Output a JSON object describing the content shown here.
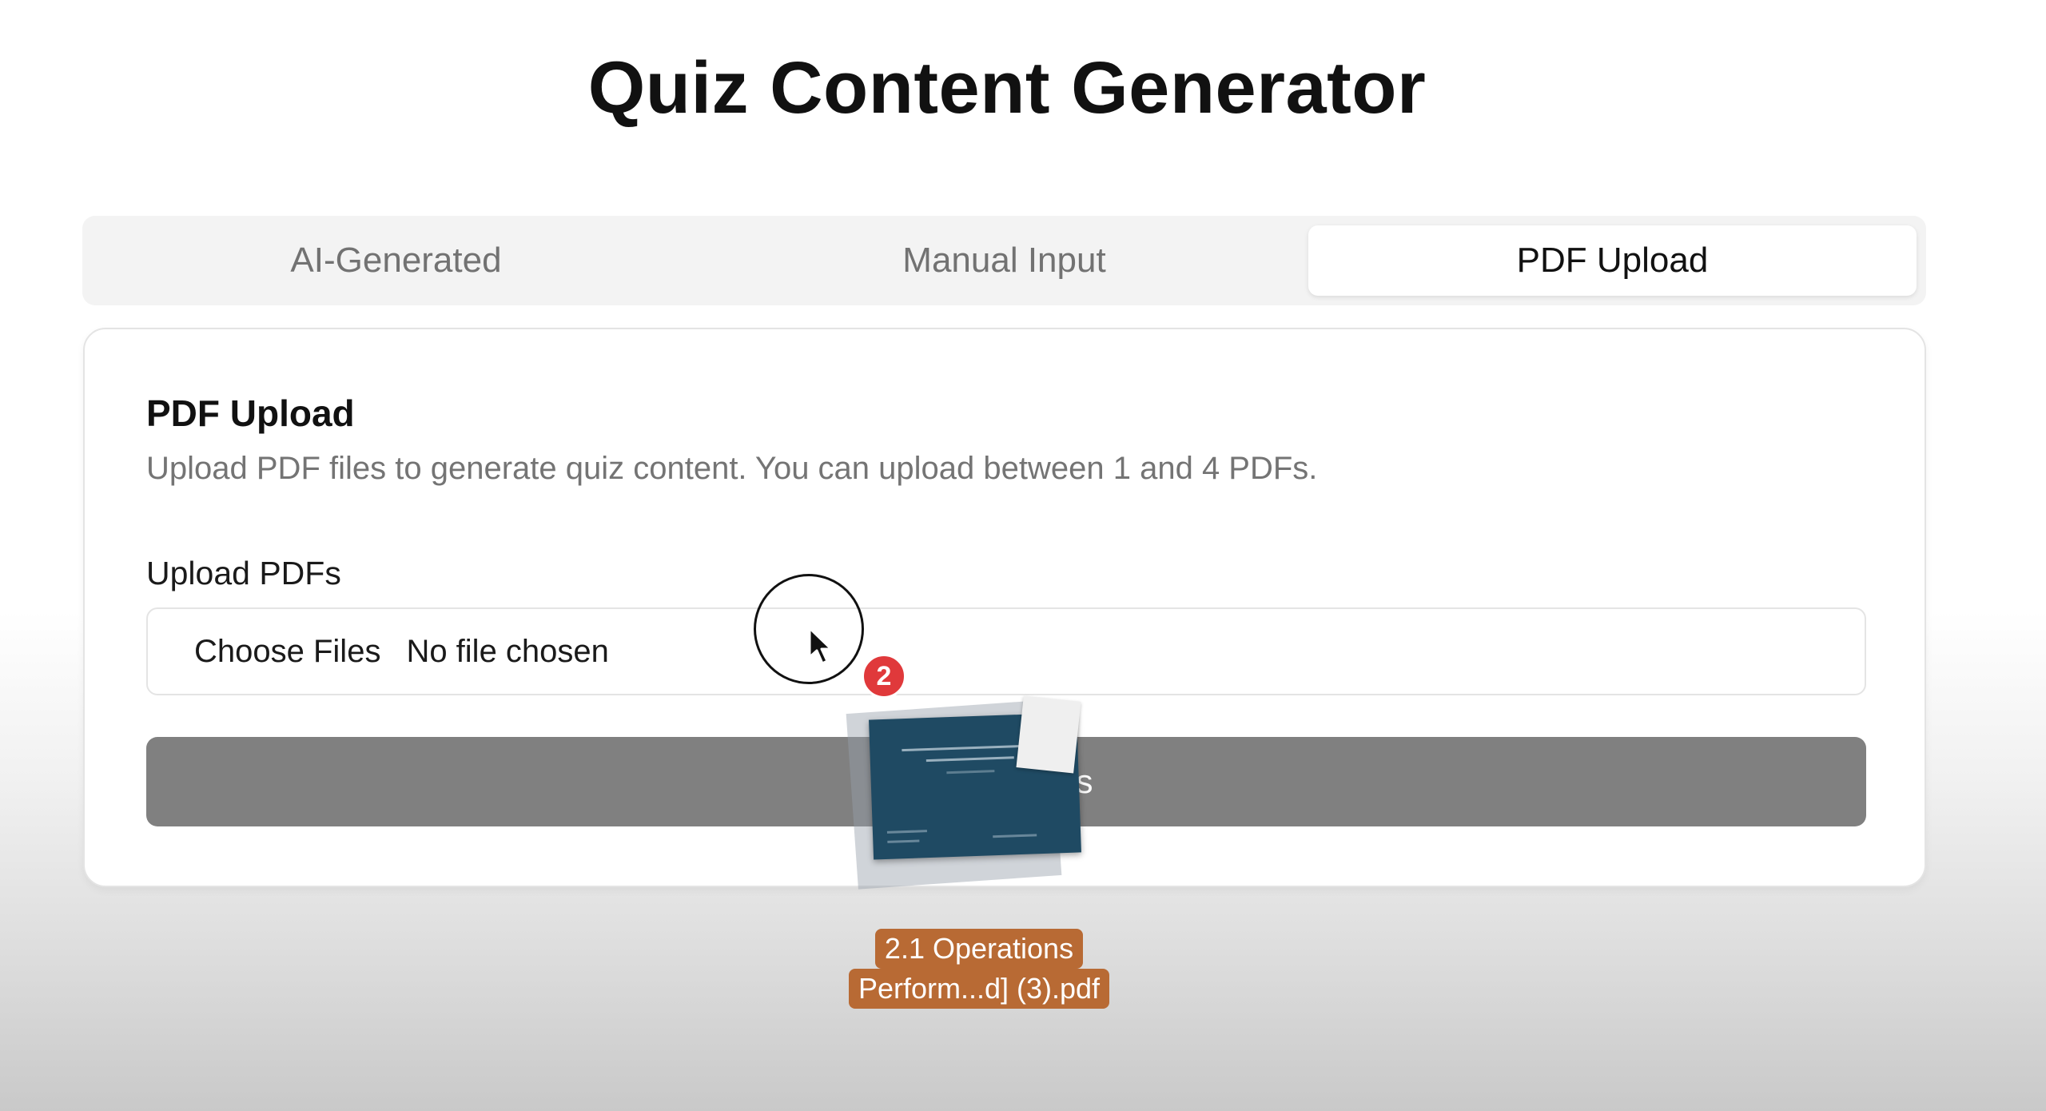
{
  "page": {
    "title": "Quiz Content Generator"
  },
  "tabs": [
    {
      "label": "AI-Generated",
      "active": false
    },
    {
      "label": "Manual Input",
      "active": false
    },
    {
      "label": "PDF Upload",
      "active": true
    }
  ],
  "card": {
    "title": "PDF Upload",
    "description": "Upload PDF files to generate quiz content. You can upload between 1 and 4 PDFs.",
    "field_label": "Upload PDFs",
    "choose_files_label": "Choose Files",
    "file_status": "No file chosen",
    "submit_label_visible": "DFs"
  },
  "drag_overlay": {
    "count_badge": "2",
    "file_name_line1": "2.1 Operations",
    "file_name_line2": "Perform...d] (3).pdf"
  },
  "colors": {
    "badge": "#e0393b",
    "file_label_bg": "#b86a34",
    "submit_button_bg": "#808080",
    "doc_thumbnail": "#1f4a63"
  },
  "icons": [
    "mouse-pointer-icon",
    "pdf-file-icon"
  ]
}
